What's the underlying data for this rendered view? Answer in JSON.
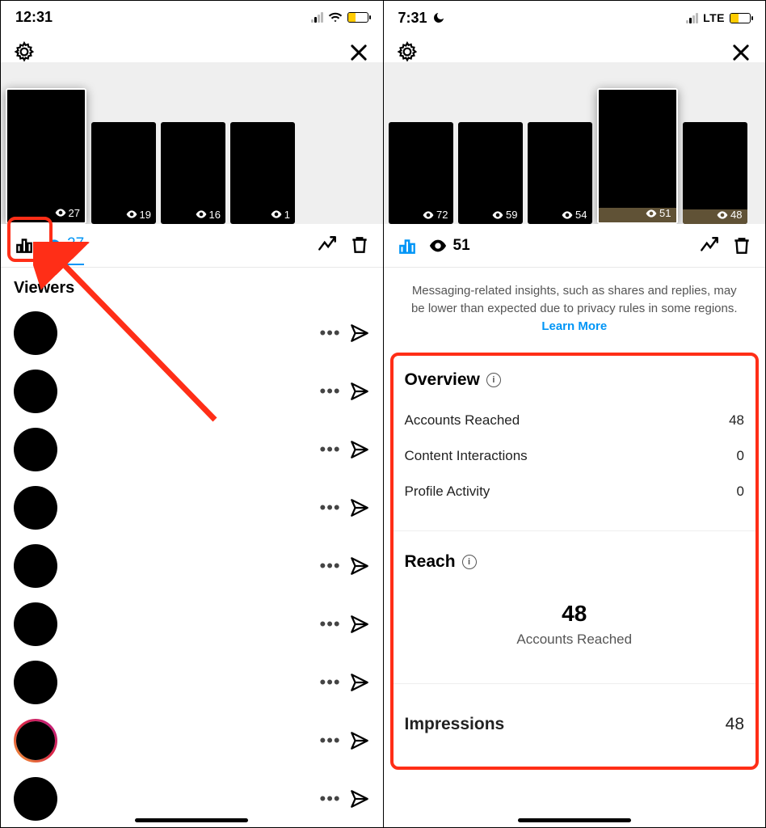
{
  "left": {
    "status_time": "12:31",
    "stories": [
      {
        "views": "27",
        "selected": true
      },
      {
        "views": "19"
      },
      {
        "views": "16"
      },
      {
        "views": "1"
      }
    ],
    "tab_count": "27",
    "viewers_title": "Viewers",
    "viewer_rows": 9
  },
  "right": {
    "status_time": "7:31",
    "net": "LTE",
    "stories": [
      {
        "views": "72"
      },
      {
        "views": "59"
      },
      {
        "views": "54"
      },
      {
        "views": "51",
        "selected": true,
        "band": true
      },
      {
        "views": "48",
        "band": true
      }
    ],
    "tab_count": "51",
    "notice_a": "Messaging-related insights, such as shares and replies, may be lower than expected due to privacy rules in some regions. ",
    "notice_link": "Learn More",
    "overview_h": "Overview",
    "overview": [
      {
        "k": "Accounts Reached",
        "v": "48"
      },
      {
        "k": "Content Interactions",
        "v": "0"
      },
      {
        "k": "Profile Activity",
        "v": "0"
      }
    ],
    "reach_h": "Reach",
    "reach_num": "48",
    "reach_lbl": "Accounts Reached",
    "impr_k": "Impressions",
    "impr_v": "48"
  }
}
